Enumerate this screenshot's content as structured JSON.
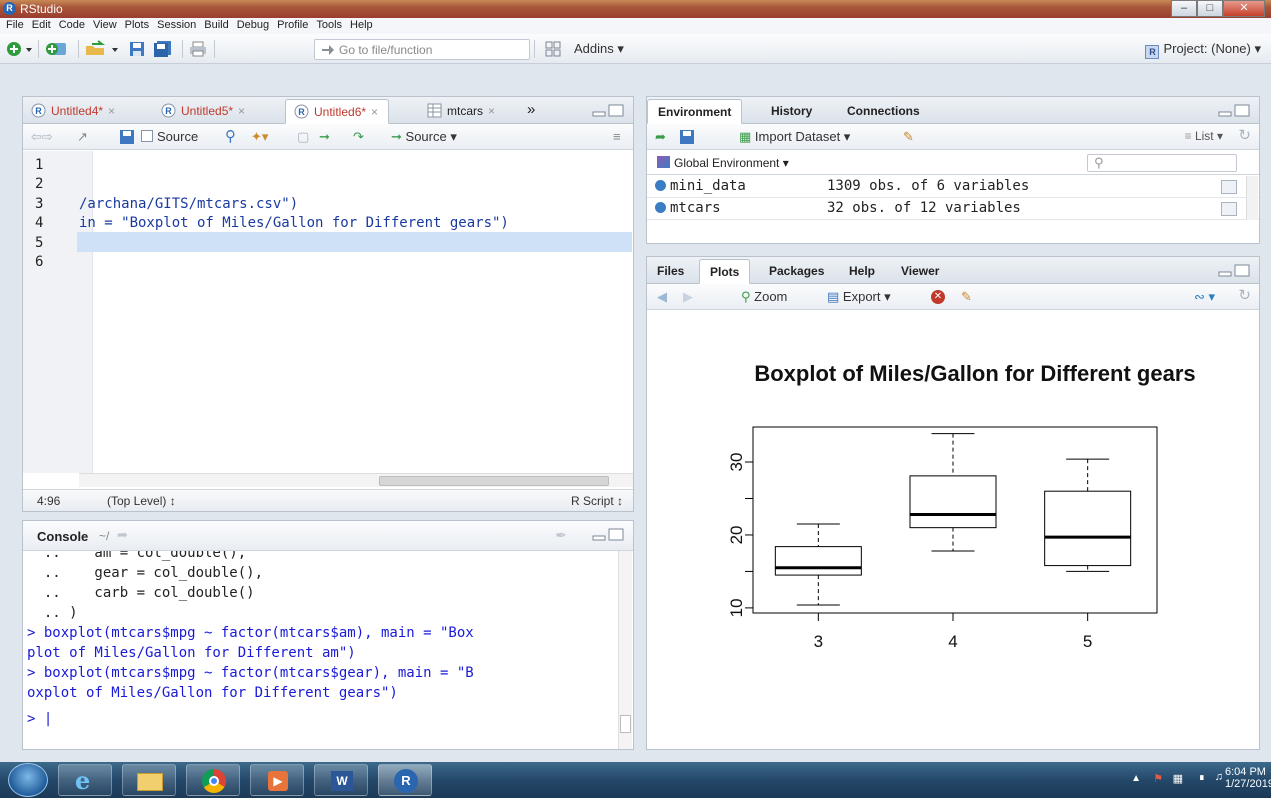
{
  "window": {
    "title": "RStudio"
  },
  "menu": [
    "File",
    "Edit",
    "Code",
    "View",
    "Plots",
    "Session",
    "Build",
    "Debug",
    "Profile",
    "Tools",
    "Help"
  ],
  "toolbar": {
    "goto_placeholder": "Go to file/function",
    "addins": "Addins ▾",
    "project": "Project: (None) ▾"
  },
  "editor": {
    "tabs": [
      "Untitled4*",
      "Untitled5*",
      "Untitled6*",
      "mtcars",
      "»"
    ],
    "source_checkbox": "Source",
    "source_button": "Source",
    "line_numbers": [
      "1",
      "2",
      "3",
      "4",
      "5",
      "6"
    ],
    "lines": [
      "",
      "",
      "/archana/GITS/mtcars.csv\")",
      "in = \"Boxplot of Miles/Gallon for Different gears\")",
      "",
      ""
    ],
    "status_pos": "4:96",
    "status_level": "(Top Level) ↕",
    "status_type": "R Script ↕"
  },
  "console": {
    "title": "Console",
    "path": "~/",
    "lines": [
      {
        "text": "  ..    am = col_double(),",
        "color": "dark"
      },
      {
        "text": "  ..    gear = col_double(),",
        "color": "dark"
      },
      {
        "text": "  ..    carb = col_double()",
        "color": "dark"
      },
      {
        "text": "  .. )",
        "color": "dark"
      },
      {
        "text": "> boxplot(mtcars$mpg ~ factor(mtcars$am), main = \"Box",
        "color": "blue"
      },
      {
        "text": "plot of Miles/Gallon for Different am\")",
        "color": "blue"
      },
      {
        "text": "> boxplot(mtcars$mpg ~ factor(mtcars$gear), main = \"B",
        "color": "blue"
      },
      {
        "text": "oxplot of Miles/Gallon for Different gears\")",
        "color": "blue"
      },
      {
        "text": "> |",
        "color": "blue"
      }
    ]
  },
  "environment": {
    "tabs": [
      "Environment",
      "History",
      "Connections"
    ],
    "import_dataset": "Import Dataset ▾",
    "view_mode": "List ▾",
    "scope": "Global Environment ▾",
    "objects": [
      {
        "name": "mini_data",
        "value": "1309 obs. of 6 variables"
      },
      {
        "name": "mtcars",
        "value": "32 obs. of 12 variables"
      }
    ]
  },
  "plots": {
    "tabs": [
      "Files",
      "Plots",
      "Packages",
      "Help",
      "Viewer"
    ],
    "zoom": "Zoom",
    "export": "Export ▾"
  },
  "chart_data": {
    "type": "boxplot",
    "title": "Boxplot of Miles/Gallon for Different gears",
    "xlabel": "",
    "ylabel": "",
    "categories": [
      "3",
      "4",
      "5"
    ],
    "boxes": [
      {
        "min": 10.4,
        "q1": 14.5,
        "median": 15.5,
        "q3": 18.4,
        "max": 21.5
      },
      {
        "min": 17.8,
        "q1": 21.0,
        "median": 22.8,
        "q3": 28.1,
        "max": 33.9
      },
      {
        "min": 15.0,
        "q1": 15.8,
        "median": 19.7,
        "q3": 26.0,
        "max": 30.4
      }
    ],
    "ylim": [
      9.3,
      34.8
    ],
    "yticks": [
      10,
      20,
      30
    ]
  },
  "taskbar": {
    "time": "6:04 PM",
    "date": "1/27/2019"
  }
}
